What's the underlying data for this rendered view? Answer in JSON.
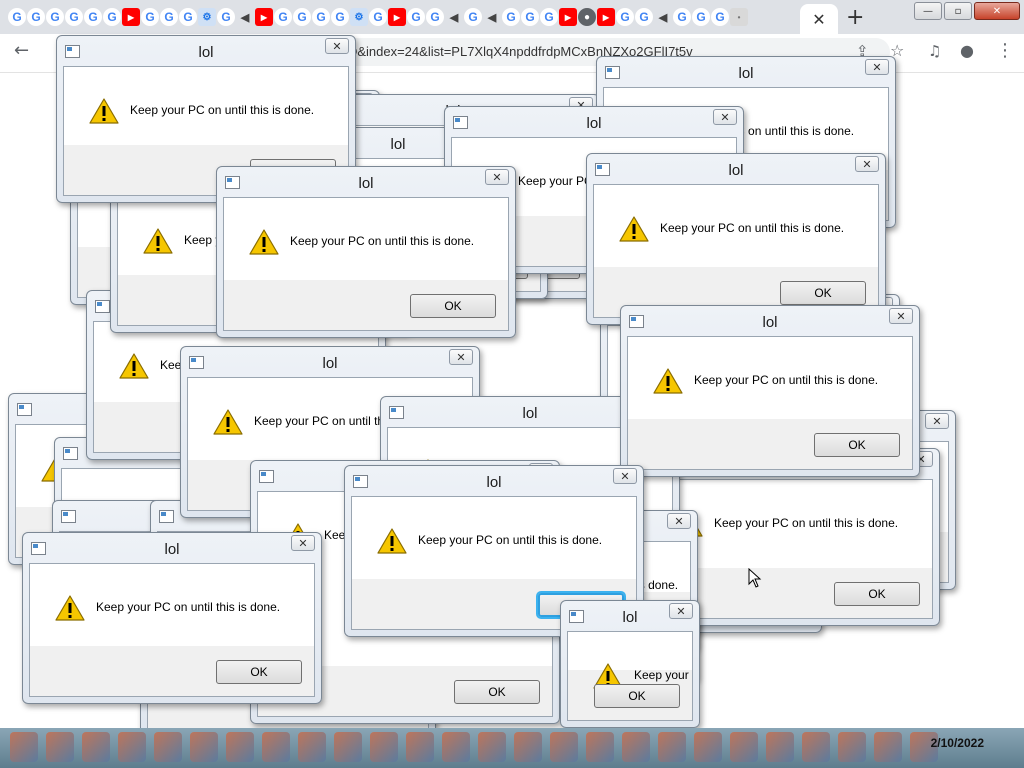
{
  "browser": {
    "url": "_Q&index=24&list=PL7XlqX4npddfrdpMCxBnNZXo2GFlI7t5v",
    "tab_icons": [
      "G",
      "G",
      "G",
      "G",
      "G",
      "G",
      "yt",
      "G",
      "G",
      "G",
      "gear",
      "G",
      "snd",
      "yt",
      "G",
      "G",
      "G",
      "G",
      "gear",
      "G",
      "yt",
      "G",
      "G",
      "snd",
      "G",
      "snd",
      "G",
      "G",
      "G",
      "yt",
      "globe",
      "yt",
      "G",
      "G",
      "snd",
      "G",
      "G",
      "G",
      "dot"
    ],
    "tab_glyphs": {
      "G": "G",
      "yt": "▶",
      "snd": "◀",
      "gear": "⚙",
      "globe": "●",
      "dot": "•"
    },
    "active_tab_close": "✕",
    "new_tab": "+",
    "back": "←",
    "share": "⇪",
    "bookmark": "☆",
    "media": "♫",
    "profile": "●",
    "menu": "⋮",
    "window_controls": {
      "minimize": "—",
      "maximize": "▫",
      "close": "✕"
    }
  },
  "dialog": {
    "title": "lol",
    "message": "Keep your PC on until this is done.",
    "ok_label": "OK",
    "close_glyph": "✕"
  },
  "dialogs": [
    {
      "id": 1
    },
    {
      "id": 2
    },
    {
      "id": 3
    },
    {
      "id": 4
    },
    {
      "id": 5
    },
    {
      "id": 6
    },
    {
      "id": 7
    },
    {
      "id": 8
    },
    {
      "id": 9
    },
    {
      "id": 10
    },
    {
      "id": 11
    },
    {
      "id": 12
    },
    {
      "id": 13
    },
    {
      "id": 14
    },
    {
      "id": 15
    },
    {
      "id": 16
    },
    {
      "id": 17
    },
    {
      "id": 18
    },
    {
      "id": 19
    },
    {
      "id": 20
    },
    {
      "id": 21
    },
    {
      "id": 22
    },
    {
      "id": 23
    },
    {
      "id": 24
    },
    {
      "id": 25
    },
    {
      "id": 26,
      "focused": true
    },
    {
      "id": 27
    },
    {
      "id": 28
    }
  ],
  "taskbar": {
    "clock": "2/10/2022",
    "app_count": 28
  },
  "colors": {
    "warning": "#f6c600",
    "focus_ring": "#2ea0e0",
    "taskbar": "#6f8fa0",
    "tab_strip": "#dee1e6"
  }
}
